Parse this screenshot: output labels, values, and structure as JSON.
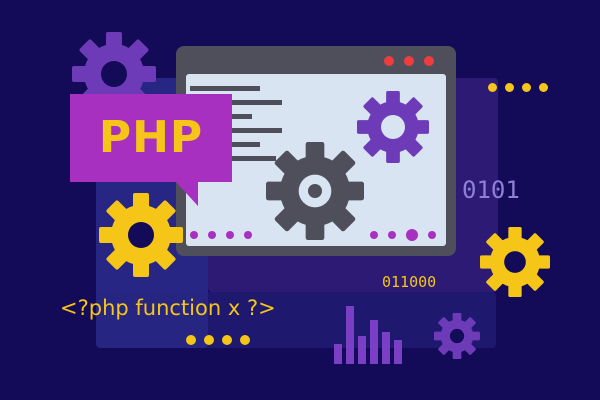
{
  "badge": {
    "label": "PHP"
  },
  "code_snippet": "<?php function x ?>",
  "binary_top": "0101",
  "binary_bottom": "011000",
  "icons": [
    "gear-icon",
    "php-speech-bubble",
    "browser-window-icon",
    "bar-chart-icon"
  ],
  "colors": {
    "background": "#130b58",
    "accent_purple": "#7b3fd0",
    "accent_yellow": "#f5c518",
    "window_frame": "#4e4f5a",
    "window_body": "#d9e4f2",
    "bubble": "#a830c0",
    "close_red": "#f03c3c"
  }
}
